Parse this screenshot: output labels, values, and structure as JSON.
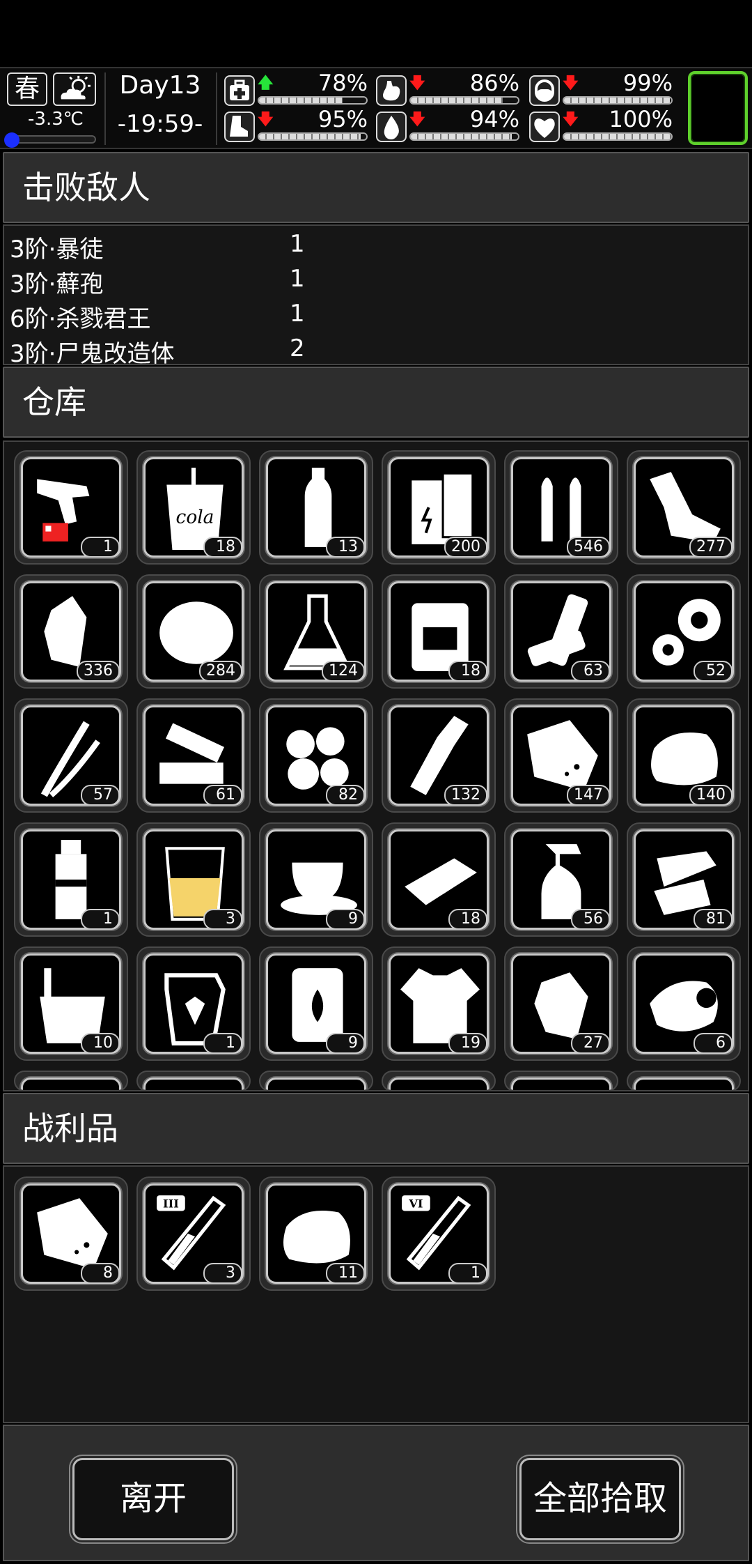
{
  "hud": {
    "season": "春",
    "weather_icon": "partly-cloudy-icon",
    "temperature": "-3.3℃",
    "day": "Day13",
    "time": "-19:59-",
    "stats": [
      {
        "icon": "medkit-icon",
        "trend": "up",
        "value_text": "78%",
        "fill": 0.78
      },
      {
        "icon": "stomach-icon",
        "trend": "down",
        "value_text": "86%",
        "fill": 0.86
      },
      {
        "icon": "pill-icon",
        "trend": "down",
        "value_text": "99%",
        "fill": 0.99
      },
      {
        "icon": "boot-icon",
        "trend": "down",
        "value_text": "95%",
        "fill": 0.95
      },
      {
        "icon": "water-drop-icon",
        "trend": "down",
        "value_text": "94%",
        "fill": 0.94
      },
      {
        "icon": "heart-icon",
        "trend": "down",
        "value_text": "100%",
        "fill": 1.0
      }
    ],
    "arrow_up": "🡅",
    "arrow_down": "🡇"
  },
  "defeated": {
    "title": "击败敌人",
    "rows": [
      {
        "name": "3阶·暴徒",
        "count": "1"
      },
      {
        "name": "3阶·蘚孢",
        "count": "1"
      },
      {
        "name": "6阶·杀戮君王",
        "count": "1"
      },
      {
        "name": "3阶·尸鬼改造体",
        "count": "2"
      }
    ]
  },
  "warehouse": {
    "title": "仓库",
    "items": [
      {
        "icon": "flare-gun-icon",
        "count": "1"
      },
      {
        "icon": "cola-cup-icon",
        "count": "18"
      },
      {
        "icon": "water-bottle-icon",
        "count": "13"
      },
      {
        "icon": "battery-pack-icon",
        "count": "200"
      },
      {
        "icon": "bullets-icon",
        "count": "546"
      },
      {
        "icon": "scrap-metal-icon",
        "count": "277"
      },
      {
        "icon": "plastic-bottle-icon",
        "count": "336"
      },
      {
        "icon": "cotton-fiber-icon",
        "count": "284"
      },
      {
        "icon": "flask-icon",
        "count": "124"
      },
      {
        "icon": "jerry-can-icon",
        "count": "18"
      },
      {
        "icon": "batteries-icon",
        "count": "63"
      },
      {
        "icon": "gears-icon",
        "count": "52"
      },
      {
        "icon": "wires-icon",
        "count": "57"
      },
      {
        "icon": "electronic-parts-icon",
        "count": "61"
      },
      {
        "icon": "cotton-balls-icon",
        "count": "82"
      },
      {
        "icon": "glass-bottle-icon",
        "count": "132"
      },
      {
        "icon": "meat-bag-icon",
        "count": "147"
      },
      {
        "icon": "cloth-icon",
        "count": "140"
      },
      {
        "icon": "cleaner-bottle-icon",
        "count": "1"
      },
      {
        "icon": "juice-glass-icon",
        "count": "3"
      },
      {
        "icon": "coffee-cup-icon",
        "count": "9"
      },
      {
        "icon": "wood-plank-icon",
        "count": "18"
      },
      {
        "icon": "spray-bottle-icon",
        "count": "56"
      },
      {
        "icon": "paper-scraps-icon",
        "count": "81"
      },
      {
        "icon": "bucket-icon",
        "count": "10"
      },
      {
        "icon": "herb-jug-icon",
        "count": "1"
      },
      {
        "icon": "fuel-barrel-icon",
        "count": "9"
      },
      {
        "icon": "rag-shirt-icon",
        "count": "19"
      },
      {
        "icon": "crumpled-paper-icon",
        "count": "27"
      },
      {
        "icon": "seed-pouch-icon",
        "count": "6"
      }
    ]
  },
  "loot": {
    "title": "战利品",
    "items": [
      {
        "icon": "meat-bag-icon",
        "count": "8"
      },
      {
        "icon": "test-tube-iii-icon",
        "count": "3",
        "tag": "III"
      },
      {
        "icon": "cloth-icon",
        "count": "11"
      },
      {
        "icon": "test-tube-vi-icon",
        "count": "1",
        "tag": "VI"
      }
    ]
  },
  "buttons": {
    "leave": "离开",
    "take_all": "全部拾取"
  }
}
